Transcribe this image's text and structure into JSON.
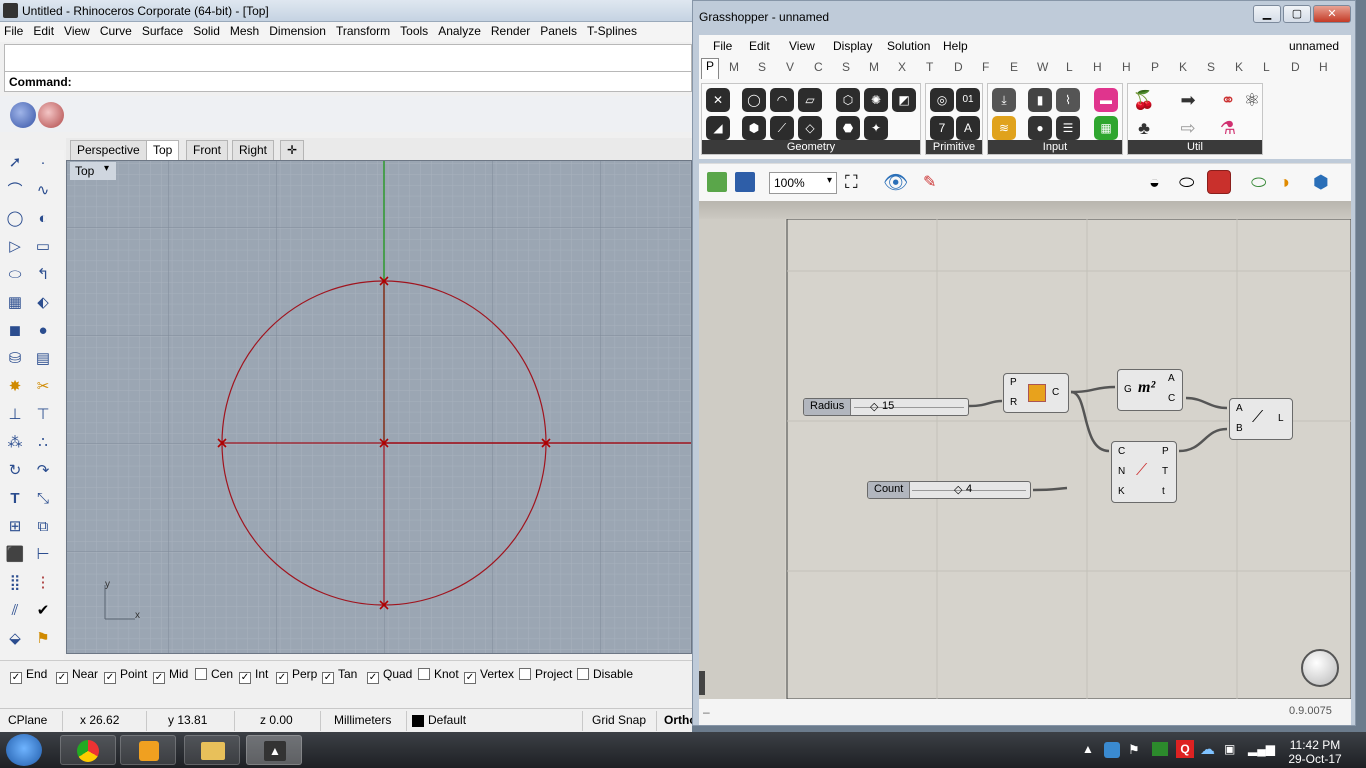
{
  "rhino": {
    "title": "Untitled - Rhinoceros Corporate (64-bit) - [Top]",
    "menu": [
      "File",
      "Edit",
      "View",
      "Curve",
      "Surface",
      "Solid",
      "Mesh",
      "Dimension",
      "Transform",
      "Tools",
      "Analyze",
      "Render",
      "Panels",
      "T-Splines"
    ],
    "command_label": "Command:",
    "viewport_tabs": [
      "Perspective",
      "Top",
      "Front",
      "Right"
    ],
    "active_tab": "Top",
    "viewport_label": "Top",
    "axis_y": "y",
    "axis_x": "x",
    "osnaps": [
      {
        "label": "End",
        "checked": true
      },
      {
        "label": "Near",
        "checked": true
      },
      {
        "label": "Point",
        "checked": true
      },
      {
        "label": "Mid",
        "checked": true
      },
      {
        "label": "Cen",
        "checked": false
      },
      {
        "label": "Int",
        "checked": true
      },
      {
        "label": "Perp",
        "checked": true
      },
      {
        "label": "Tan",
        "checked": true
      },
      {
        "label": "Quad",
        "checked": true
      },
      {
        "label": "Knot",
        "checked": false
      },
      {
        "label": "Vertex",
        "checked": true
      },
      {
        "label": "Project",
        "checked": false
      },
      {
        "label": "Disable",
        "checked": false
      }
    ],
    "status": {
      "cplane": "CPlane",
      "x": "x 26.62",
      "y": "y 13.81",
      "z": "z 0.00",
      "units": "Millimeters",
      "layer": "Default",
      "grid_snap": "Grid Snap",
      "ortho": "Ortho"
    }
  },
  "grasshopper": {
    "title": "Grasshopper - unnamed",
    "doc_name": "unnamed",
    "menu": [
      "File",
      "Edit",
      "View",
      "Display",
      "Solution",
      "Help"
    ],
    "tabs": [
      "P",
      "M",
      "S",
      "V",
      "C",
      "S",
      "M",
      "X",
      "T",
      "D",
      "F",
      "E",
      "W",
      "L",
      "H",
      "H",
      "P",
      "K",
      "S",
      "K",
      "L",
      "D",
      "H"
    ],
    "active_tab": "P",
    "panels": [
      "Geometry",
      "Primitive",
      "Input",
      "Util"
    ],
    "zoom": "100%",
    "version": "0.9.0075",
    "components": {
      "radius_slider": {
        "label": "Radius",
        "value": "15"
      },
      "count_slider": {
        "label": "Count",
        "value": "4"
      },
      "circle": {
        "inputs": [
          "P",
          "R"
        ],
        "outputs": [
          "C"
        ]
      },
      "area": {
        "inputs": [
          "G"
        ],
        "outputs": [
          "A",
          "C"
        ],
        "symbol": "m²"
      },
      "divide": {
        "inputs": [
          "C",
          "N",
          "K"
        ],
        "outputs": [
          "P",
          "T",
          "t"
        ]
      },
      "line": {
        "inputs": [
          "A",
          "B"
        ],
        "outputs": [
          "L"
        ]
      }
    }
  },
  "taskbar": {
    "time": "11:42 PM",
    "date": "29-Oct-17"
  },
  "colors": {
    "curve_red": "#a0141e",
    "axis_green": "#2e9a2e",
    "viewport_bg": "#9ba6b3",
    "gh_canvas": "#d6d3cc"
  }
}
